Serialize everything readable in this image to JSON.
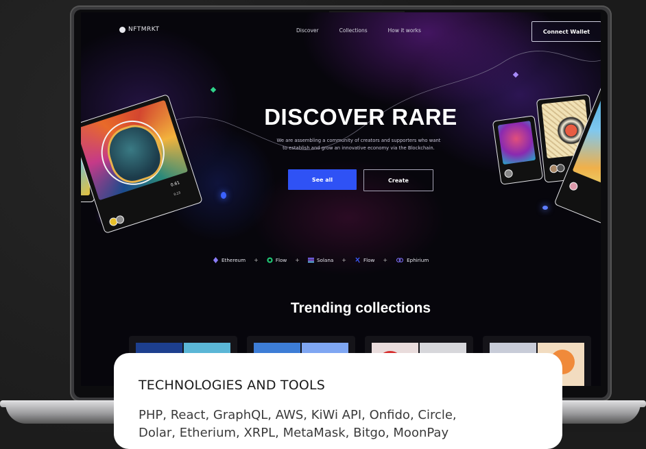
{
  "nav": {
    "logo": "NFTMRKT",
    "links": [
      "Discover",
      "Collections",
      "How it works"
    ],
    "cta": "Connect Wallet"
  },
  "hero": {
    "title": "DISCOVER RARE",
    "subtitle_line1": "We are assembling a community of creators and supporters who want",
    "subtitle_line2": "to establish and grow an innovative economy via the Blockchain.",
    "primary_button": "See all",
    "secondary_button": "Create"
  },
  "chains": [
    {
      "name": "Ethereum",
      "icon": "ethereum-icon",
      "color": "#8a7cf6"
    },
    {
      "name": "Flow",
      "icon": "flow-icon",
      "color": "#22d07a"
    },
    {
      "name": "Solana",
      "icon": "solana-icon",
      "color": "#7d6bff"
    },
    {
      "name": "Flow",
      "icon": "flow-alt-icon",
      "color": "#3b5cff"
    },
    {
      "name": "Ephirium",
      "icon": "link-chain-icon",
      "color": "#7a6cf0"
    }
  ],
  "section": {
    "trending_title": "Trending collections"
  },
  "nft_cards": {
    "main_price": "0.61",
    "main_sub": "0.23"
  },
  "overlay": {
    "title": "TECHNOLOGIES AND TOOLS",
    "body_line1": "PHP, React, GraphQL, AWS, KiWi API, Onfido, Circle,",
    "body_line2": "Dolar, Etherium, XRPL, MetaMask, Bitgo, MoonPay"
  },
  "colors": {
    "accent_blue": "#2f52f5",
    "background": "#07060c"
  }
}
